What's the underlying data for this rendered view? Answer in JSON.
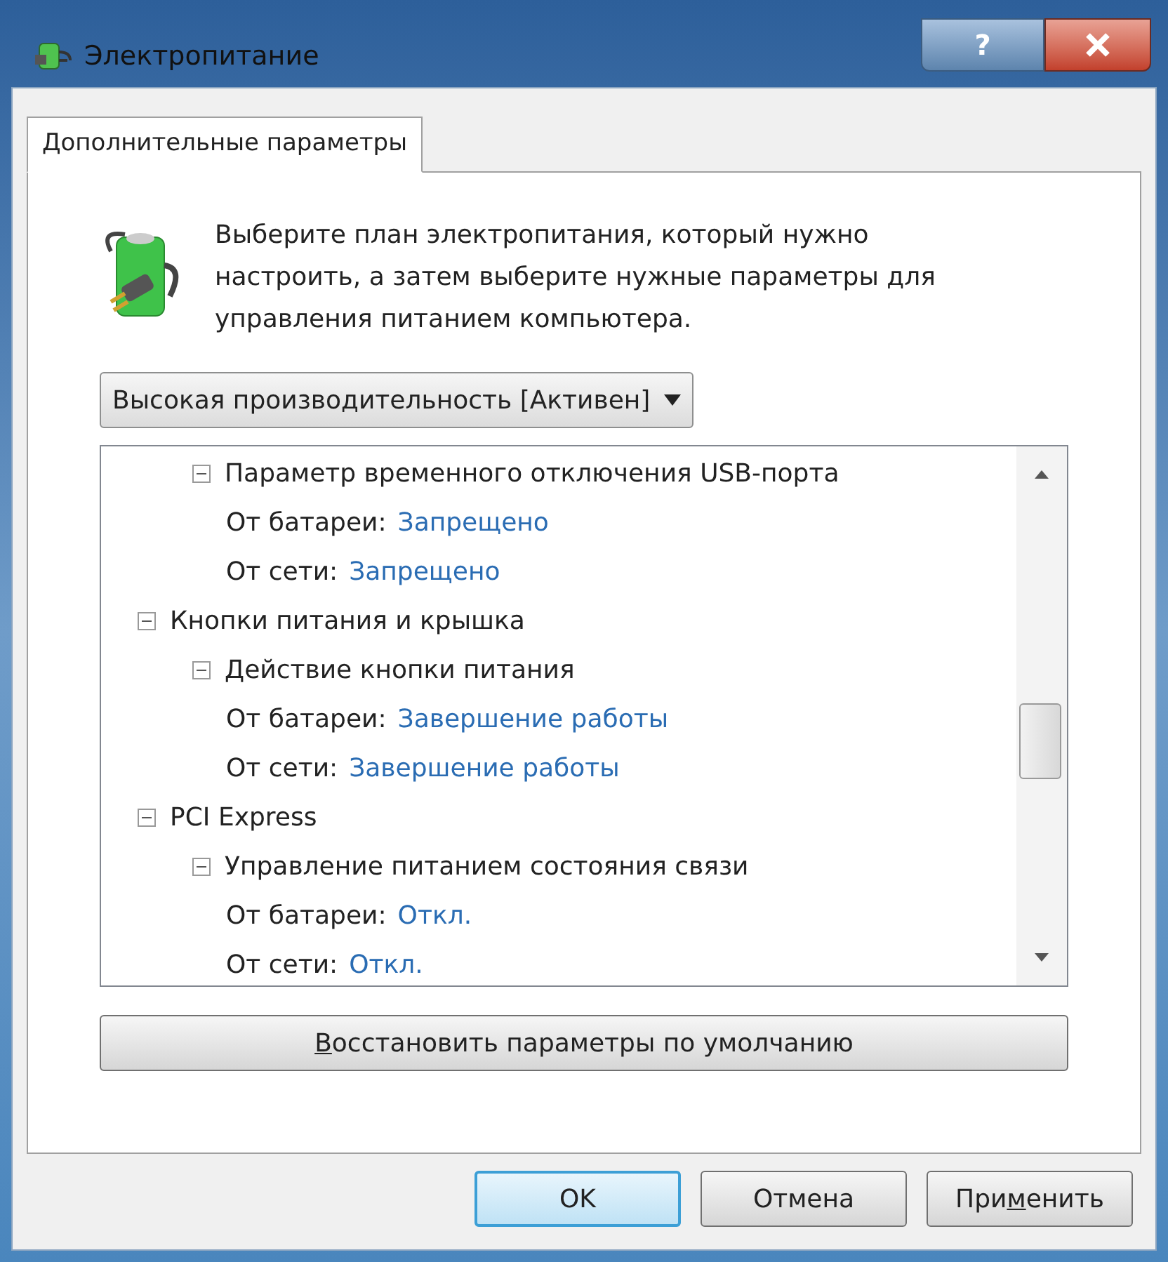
{
  "window": {
    "title": "Электропитание",
    "help_button": "?"
  },
  "tabs": [
    {
      "label": "Дополнительные параметры",
      "selected": true
    }
  ],
  "description": "Выберите план электропитания, который нужно настроить, а затем выберите нужные параметры для управления питанием компьютера.",
  "plan_dropdown": {
    "value": "Высокая производительность [Активен]"
  },
  "tree": {
    "items": [
      {
        "kind": "root",
        "children": [
          {
            "kind": "group",
            "label": "Параметр временного отключения USB-порта",
            "expanded": true,
            "children": [
              {
                "kind": "setting",
                "label": "От батареи:",
                "value": "Запрещено"
              },
              {
                "kind": "setting",
                "label": "От сети:",
                "value": "Запрещено"
              }
            ]
          }
        ]
      },
      {
        "kind": "group",
        "label": "Кнопки питания и крышка",
        "expanded": true,
        "children": [
          {
            "kind": "group",
            "label": "Действие кнопки питания",
            "expanded": true,
            "children": [
              {
                "kind": "setting",
                "label": "От батареи:",
                "value": "Завершение работы"
              },
              {
                "kind": "setting",
                "label": "От сети:",
                "value": "Завершение работы"
              }
            ]
          }
        ]
      },
      {
        "kind": "group",
        "label": "PCI Express",
        "expanded": true,
        "children": [
          {
            "kind": "group",
            "label": "Управление питанием состояния связи",
            "expanded": true,
            "children": [
              {
                "kind": "setting",
                "label": "От батареи:",
                "value": "Откл."
              },
              {
                "kind": "setting",
                "label": "От сети:",
                "value": "Откл."
              }
            ]
          }
        ]
      }
    ]
  },
  "restore_button": {
    "access_key": "В",
    "label_rest": "осстановить параметры по умолчанию"
  },
  "buttons": [
    {
      "kind": "default",
      "label_before": "OK"
    },
    {
      "kind": "normal",
      "label_before": "Отмена"
    },
    {
      "kind": "normal",
      "label_before": "При",
      "access_key": "м",
      "label_rest": "енить"
    }
  ]
}
